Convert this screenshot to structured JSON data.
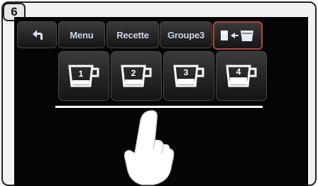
{
  "step_number": "6",
  "header": {
    "back_icon": "back-arrow-icon",
    "tabs": [
      {
        "label": "Menu"
      },
      {
        "label": "Recette"
      },
      {
        "label": "Groupe3"
      }
    ],
    "selected_tab_icon": "swap-container-icon"
  },
  "cups": [
    {
      "label": "1"
    },
    {
      "label": "2"
    },
    {
      "label": "3"
    },
    {
      "label": "4"
    }
  ],
  "colors": {
    "screen_bg": "#050505",
    "button_text": "#c9d6ee",
    "selected_border": "#b7443a"
  }
}
